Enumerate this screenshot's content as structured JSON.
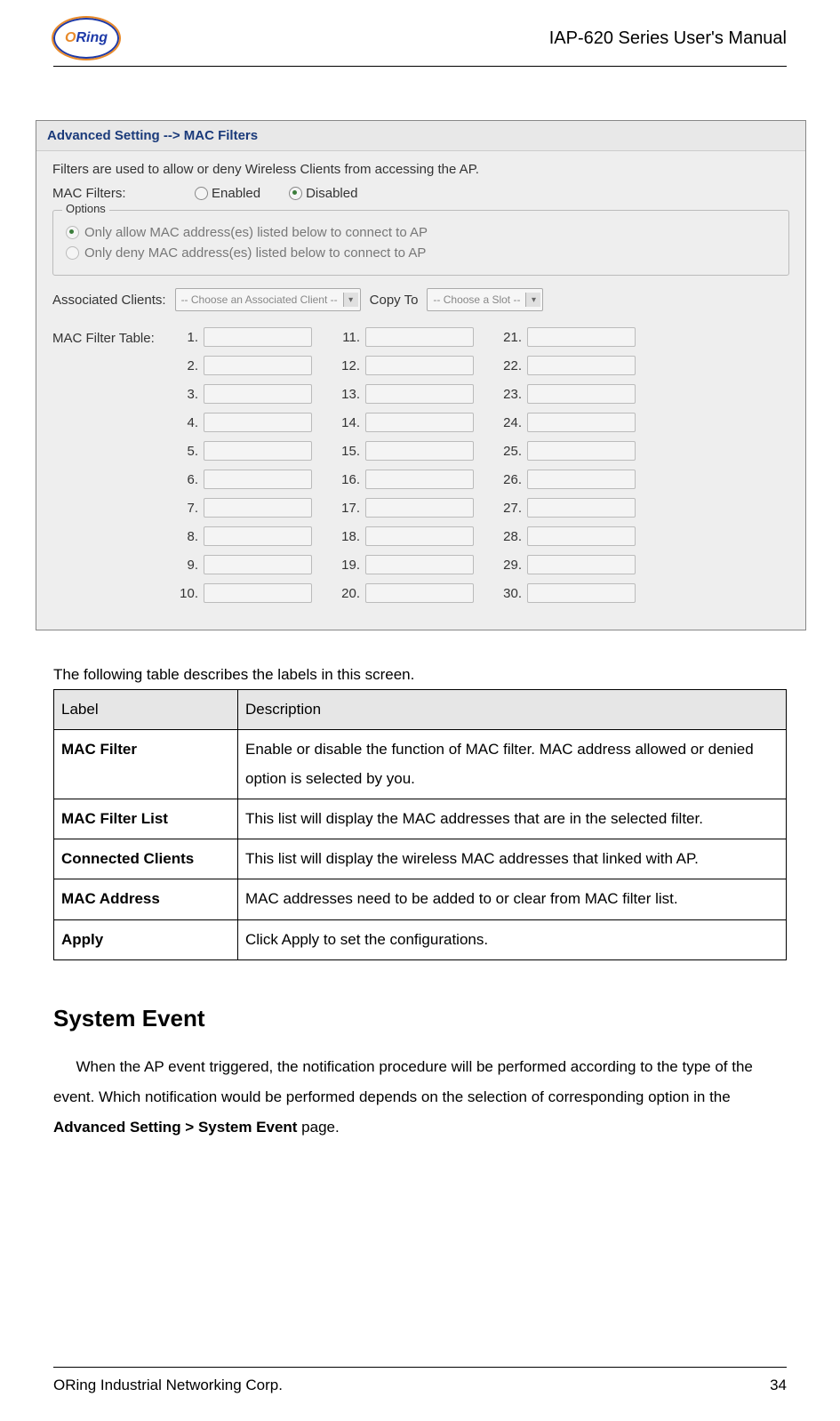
{
  "header": {
    "logo_text": "ORing",
    "doc_title": "IAP-620 Series User's Manual"
  },
  "screenshot": {
    "titlebar": "Advanced Setting --> MAC Filters",
    "intro": "Filters are used to allow or deny Wireless Clients from accessing the AP.",
    "mac_filters_label": "MAC Filters:",
    "enabled_label": "Enabled",
    "disabled_label": "Disabled",
    "options_legend": "Options",
    "opt_allow": "Only allow MAC address(es) listed below to connect to AP",
    "opt_deny": "Only deny MAC address(es) listed below to connect to AP",
    "assoc_label": "Associated Clients:",
    "assoc_select": "-- Choose an Associated Client --",
    "copy_to_label": "Copy To",
    "copy_to_select": "-- Choose a Slot --",
    "mac_table_label": "MAC Filter Table:",
    "col1": [
      "1.",
      "2.",
      "3.",
      "4.",
      "5.",
      "6.",
      "7.",
      "8.",
      "9.",
      "10."
    ],
    "col2": [
      "11.",
      "12.",
      "13.",
      "14.",
      "15.",
      "16.",
      "17.",
      "18.",
      "19.",
      "20."
    ],
    "col3": [
      "21.",
      "22.",
      "23.",
      "24.",
      "25.",
      "26.",
      "27.",
      "28.",
      "29.",
      "30."
    ]
  },
  "table_intro": "The following table describes the labels in this screen.",
  "desc_table": {
    "header_label": "Label",
    "header_desc": "Description",
    "rows": [
      {
        "label": "MAC Filter",
        "desc": "Enable or disable the function of MAC filter.   MAC address allowed or denied option is selected by you."
      },
      {
        "label": "MAC Filter List",
        "desc": "This list will display the MAC addresses that are in the selected filter."
      },
      {
        "label": "Connected Clients",
        "desc": "This list will display the wireless MAC addresses that linked with AP."
      },
      {
        "label": "MAC Address",
        "desc": "MAC addresses need to be added to or clear from MAC filter list."
      },
      {
        "label": "Apply",
        "desc": "Click Apply to set the configurations."
      }
    ]
  },
  "section_heading": "System Event",
  "section_para_pre": "When the AP event triggered, the notification procedure will be performed according to the type of the event.   Which notification would be performed depends on the selection of corresponding option in the ",
  "section_para_strong": "Advanced Setting > System Event",
  "section_para_post": " page.",
  "footer": {
    "company": "ORing Industrial Networking Corp.",
    "page": "34"
  }
}
